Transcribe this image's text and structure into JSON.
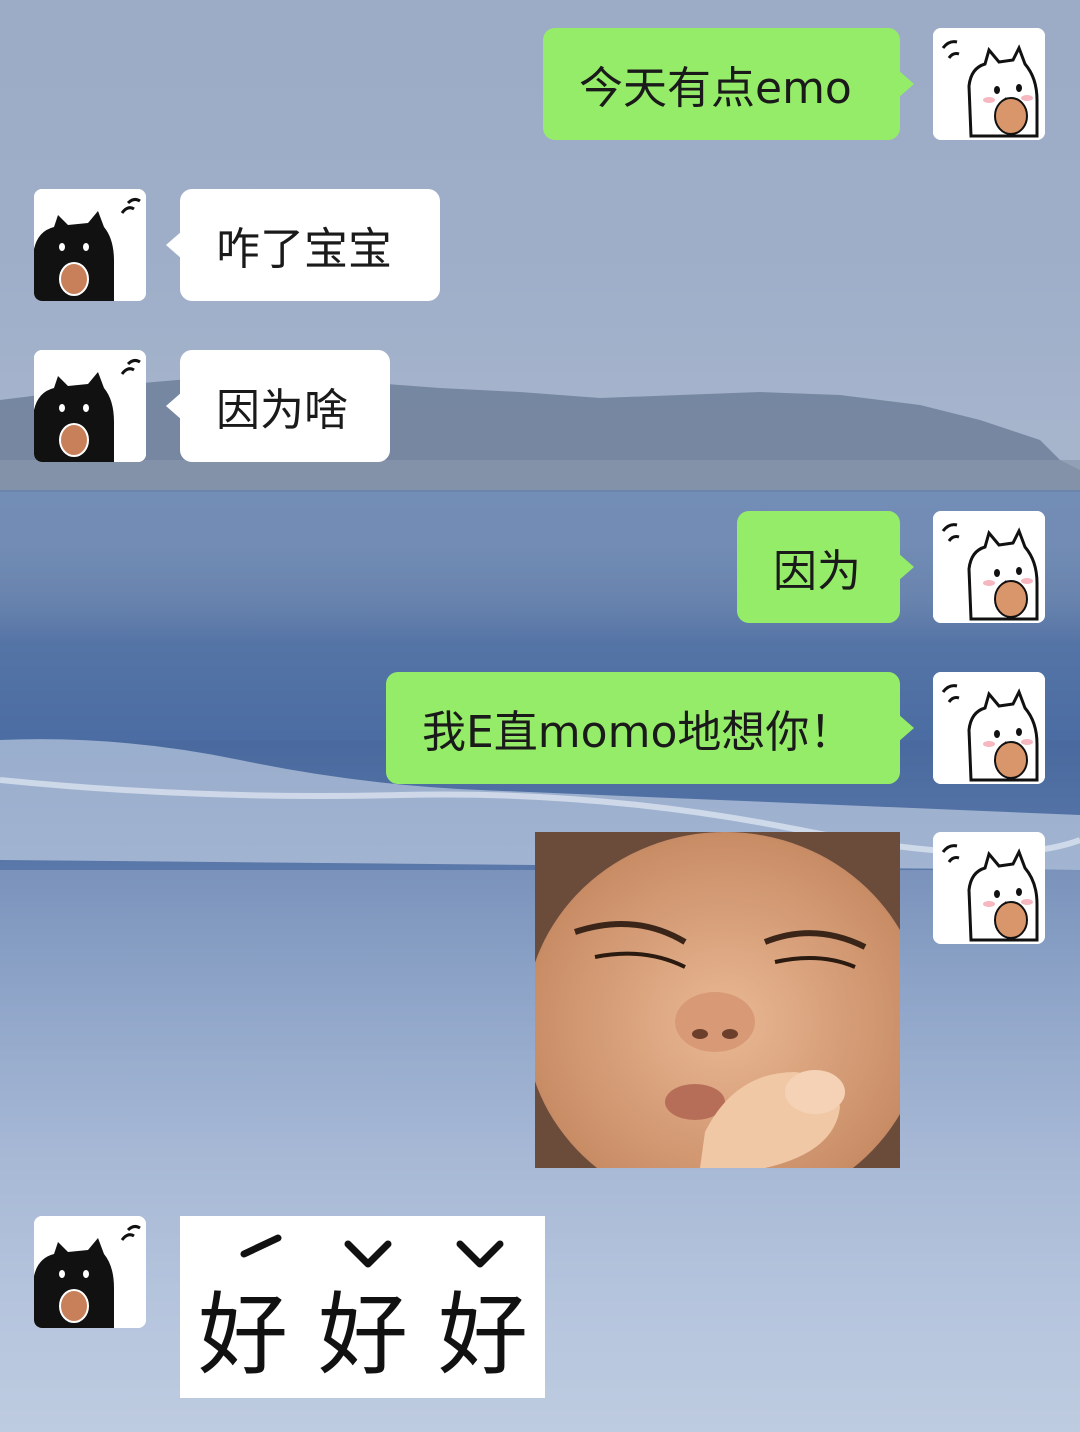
{
  "chat": {
    "messages": [
      {
        "side": "right",
        "type": "text",
        "text": "今天有点emo"
      },
      {
        "side": "left",
        "type": "text",
        "text": "咋了宝宝"
      },
      {
        "side": "left",
        "type": "text",
        "text": "因为啥"
      },
      {
        "side": "right",
        "type": "text",
        "text": "因为"
      },
      {
        "side": "right",
        "type": "text",
        "text": "我E直momo地想你！"
      },
      {
        "side": "right",
        "type": "image",
        "description_icon": "crying-child-meme"
      },
      {
        "side": "left",
        "type": "sticker",
        "text": "好好好",
        "tones": [
          "ˊ",
          "ˇ",
          "ˇ"
        ]
      }
    ]
  },
  "colors": {
    "green_bubble": "#95ec69",
    "white_bubble": "#ffffff"
  },
  "icons": {
    "right_avatar": "white-cat-avatar-icon",
    "left_avatar": "black-cat-avatar-icon"
  }
}
